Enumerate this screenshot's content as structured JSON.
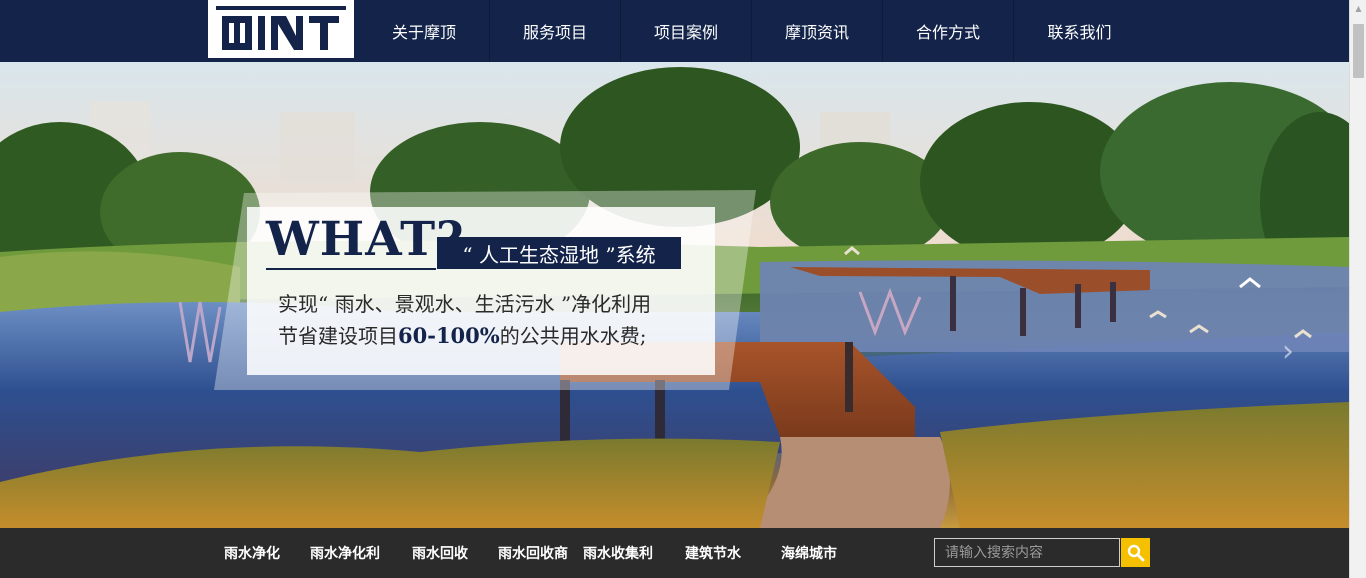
{
  "logo": {
    "text": "MINT",
    "icon": "mint-logo"
  },
  "nav": {
    "items": [
      {
        "label": "关于摩顶"
      },
      {
        "label": "服务项目"
      },
      {
        "label": "项目案例"
      },
      {
        "label": "摩顶资讯"
      },
      {
        "label": "合作方式"
      },
      {
        "label": "联系我们"
      }
    ]
  },
  "banner": {
    "headline": "WHAT?",
    "system_label": "“ 人工生态湿地 ”系统",
    "line1": "实现“ 雨水、景观水、生活污水 ”净化利用",
    "line2_prefix": "节省建设项目",
    "line2_highlight": "60-100%",
    "line2_suffix": "的公共用水水费;",
    "next_icon": "chevron-right-icon"
  },
  "footer": {
    "keywords": [
      "雨水净化",
      "雨水净化利",
      "雨水回收",
      "雨水回收商",
      "雨水收集利",
      "建筑节水",
      "海绵城市"
    ],
    "search_placeholder": "请输入搜索内容",
    "search_icon": "search-icon",
    "accent_color": "#f5c000"
  },
  "colors": {
    "navy": "#13234a",
    "bottom_bar": "#2b2b2b"
  }
}
